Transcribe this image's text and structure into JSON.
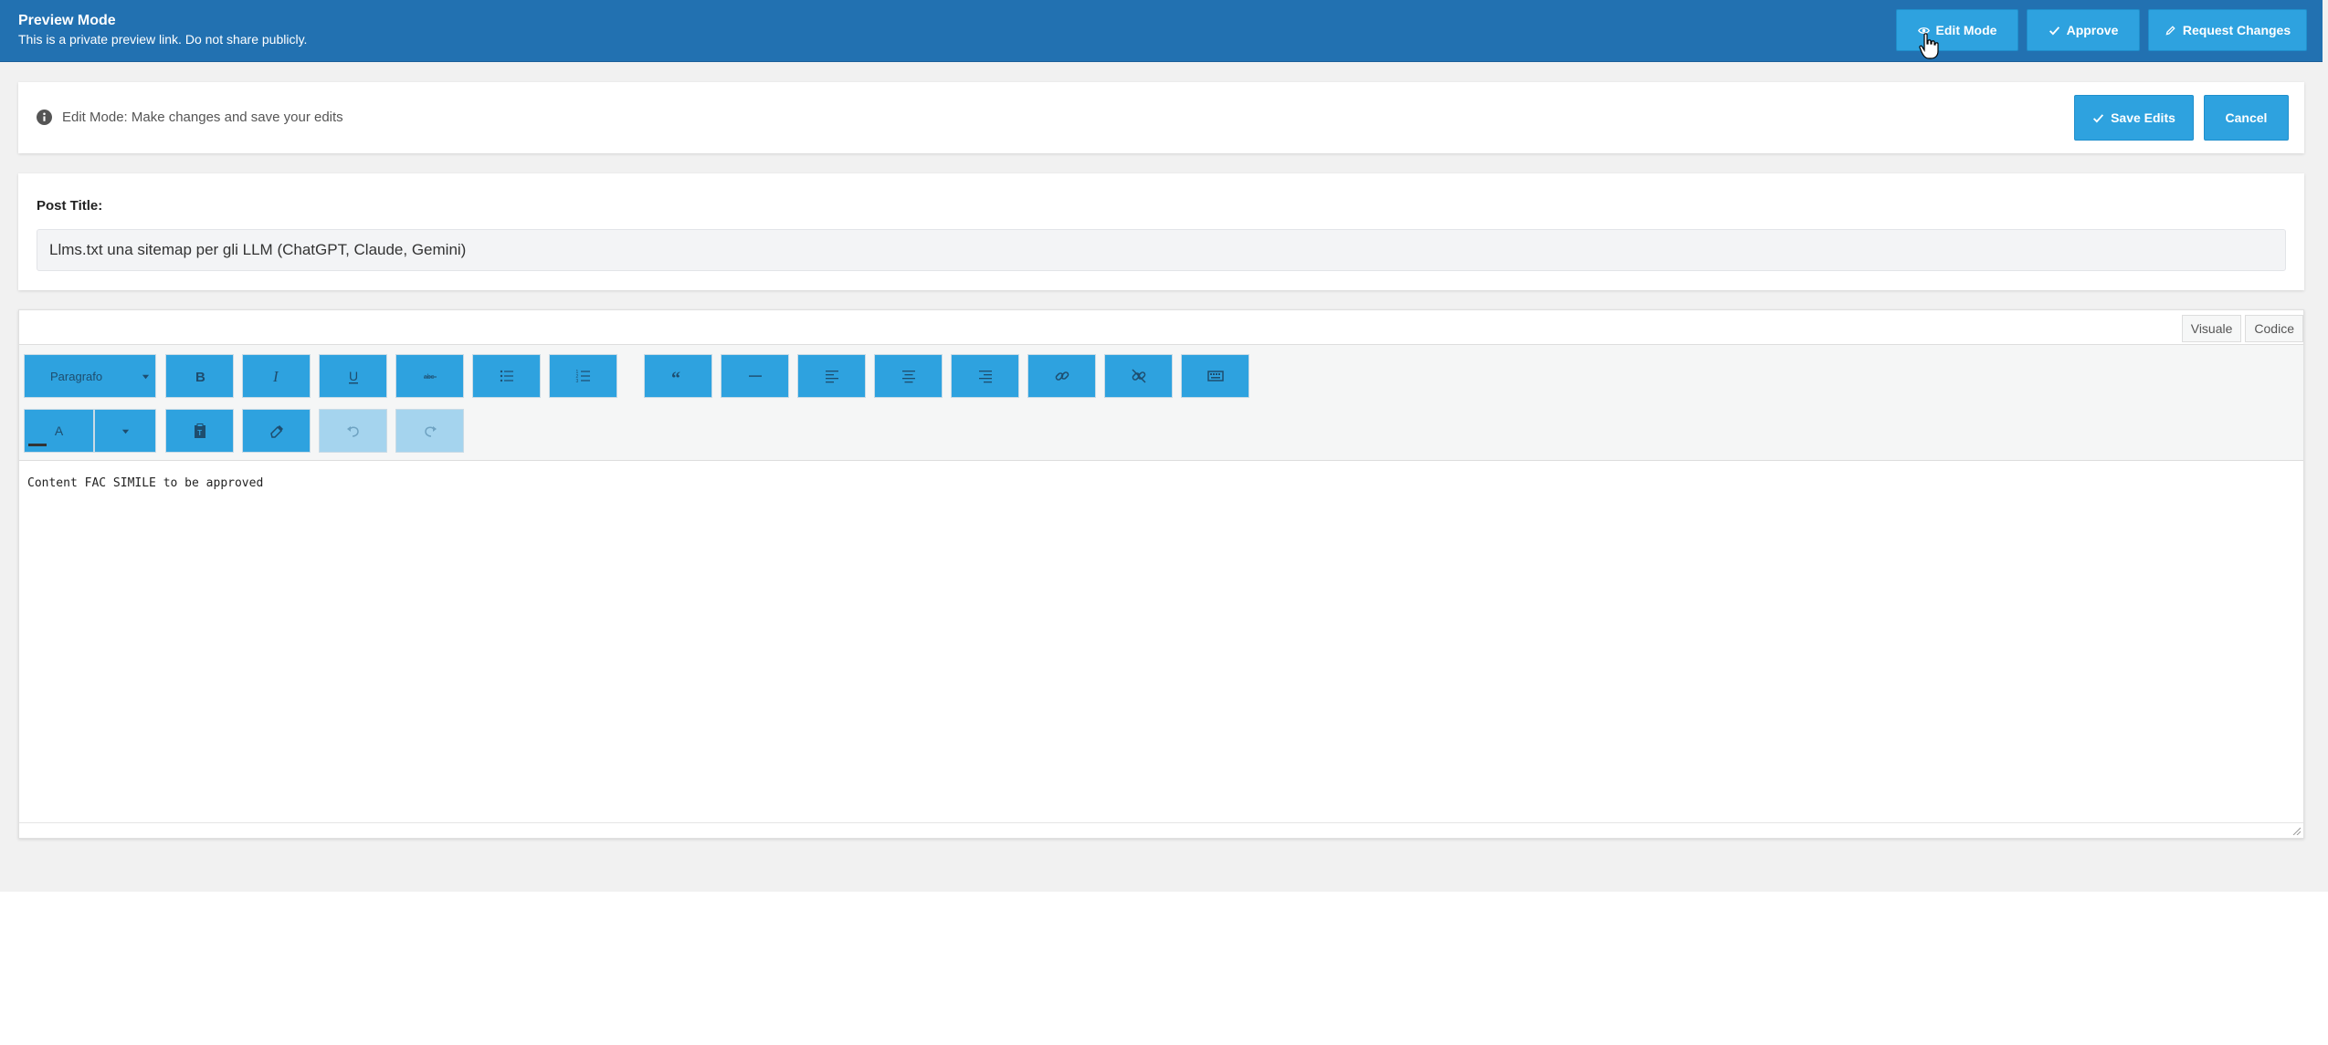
{
  "topbar": {
    "title": "Preview Mode",
    "subtitle": "This is a private preview link. Do not share publicly.",
    "buttons": {
      "edit_mode": "Edit Mode",
      "approve": "Approve",
      "request_changes": "Request Changes"
    }
  },
  "notice": {
    "message": "Edit Mode: Make changes and save your edits",
    "save_edits": "Save Edits",
    "cancel": "Cancel"
  },
  "post": {
    "title_label": "Post Title:",
    "title_value": "Llms.txt una sitemap per gli LLM (ChatGPT, Claude, Gemini)"
  },
  "editor": {
    "tabs": {
      "visual": "Visuale",
      "code": "Codice"
    },
    "format_select": "Paragrafo",
    "text_color_label": "A",
    "content": "Content FAC SIMILE to be approved"
  },
  "colors": {
    "topbar": "#2271b1",
    "button": "#2ea2df",
    "page_bg": "#f1f1f1"
  }
}
